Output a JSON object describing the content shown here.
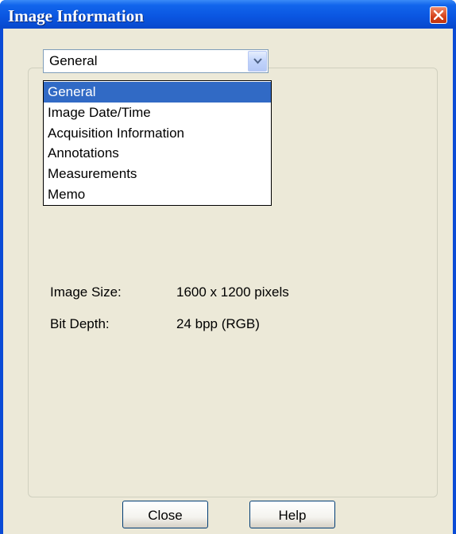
{
  "window": {
    "title": "Image Information"
  },
  "icons": {
    "close": "close-icon",
    "dropdown_arrow": "chevron-down-icon"
  },
  "combo": {
    "selected": "General",
    "options": [
      "General",
      "Image Date/Time",
      "Acquisition Information",
      "Annotations",
      "Measurements",
      "Memo"
    ]
  },
  "info": {
    "image_size_label": "Image Size:",
    "image_size_value": "1600 x 1200 pixels",
    "bit_depth_label": "Bit Depth:",
    "bit_depth_value": "24 bpp (RGB)"
  },
  "buttons": {
    "close": "Close",
    "help": "Help"
  },
  "colors": {
    "titlebar": "#0a55e0",
    "highlight": "#316ac5",
    "dialog_bg": "#ece9d8",
    "close_button": "#d4421a"
  }
}
